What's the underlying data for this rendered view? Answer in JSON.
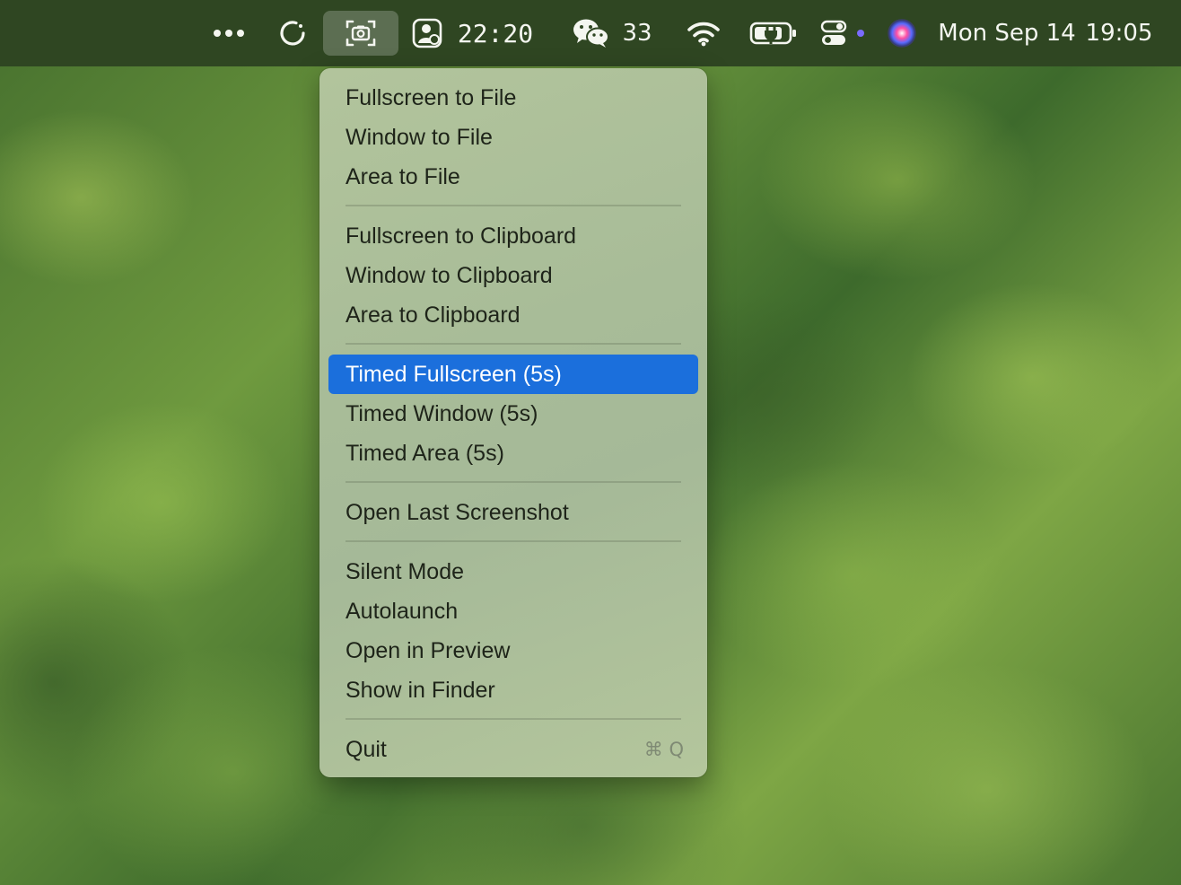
{
  "menubar": {
    "timer_text": "22:20",
    "wechat_count": "33",
    "date_text": "Mon Sep 14",
    "time_text": "19:05",
    "icons": {
      "more": "ellipsis-icon",
      "sync": "circular-arrow-icon",
      "screenshot": "camera-icon",
      "tracker": "person-card-icon",
      "wechat": "wechat-icon",
      "wifi": "wifi-icon",
      "battery": "battery-charging-icon",
      "control_center": "toggles-icon",
      "siri": "siri-icon"
    }
  },
  "menu": {
    "groups": [
      {
        "items": [
          {
            "label": "Fullscreen to File"
          },
          {
            "label": "Window to File"
          },
          {
            "label": "Area to File"
          }
        ]
      },
      {
        "items": [
          {
            "label": "Fullscreen to Clipboard"
          },
          {
            "label": "Window to Clipboard"
          },
          {
            "label": "Area to Clipboard"
          }
        ]
      },
      {
        "items": [
          {
            "label": "Timed Fullscreen (5s)",
            "highlighted": true
          },
          {
            "label": "Timed Window (5s)"
          },
          {
            "label": "Timed Area (5s)"
          }
        ]
      },
      {
        "items": [
          {
            "label": "Open Last Screenshot"
          }
        ]
      },
      {
        "items": [
          {
            "label": "Silent Mode"
          },
          {
            "label": "Autolaunch"
          },
          {
            "label": "Open in Preview"
          },
          {
            "label": "Show in Finder"
          }
        ]
      },
      {
        "items": [
          {
            "label": "Quit",
            "shortcut": "⌘ Q"
          }
        ]
      }
    ]
  },
  "colors": {
    "menubar_bg": "#2f4622",
    "highlight": "#1b6fdc",
    "siri_dot": "#7a6bff"
  }
}
